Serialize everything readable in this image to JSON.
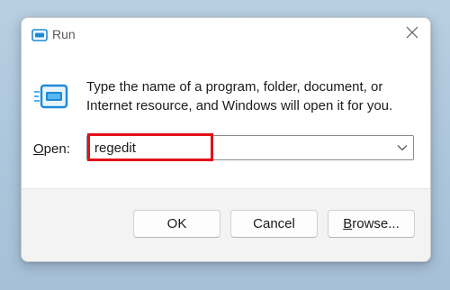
{
  "window": {
    "title": "Run",
    "icon": "run-icon",
    "close_icon": "close-icon"
  },
  "content": {
    "description": "Type the name of a program, folder, document, or Internet resource, and Windows will open it for you.",
    "open_label_mnemonic": "O",
    "open_label_rest": "pen:",
    "open_value": "regedit"
  },
  "buttons": {
    "ok": "OK",
    "cancel": "Cancel",
    "browse_mnemonic": "B",
    "browse_rest": "rowse..."
  },
  "colors": {
    "highlight": "#e3101a",
    "icon_blue": "#1c8ad6",
    "dialog_bg": "#f3f3f3"
  }
}
